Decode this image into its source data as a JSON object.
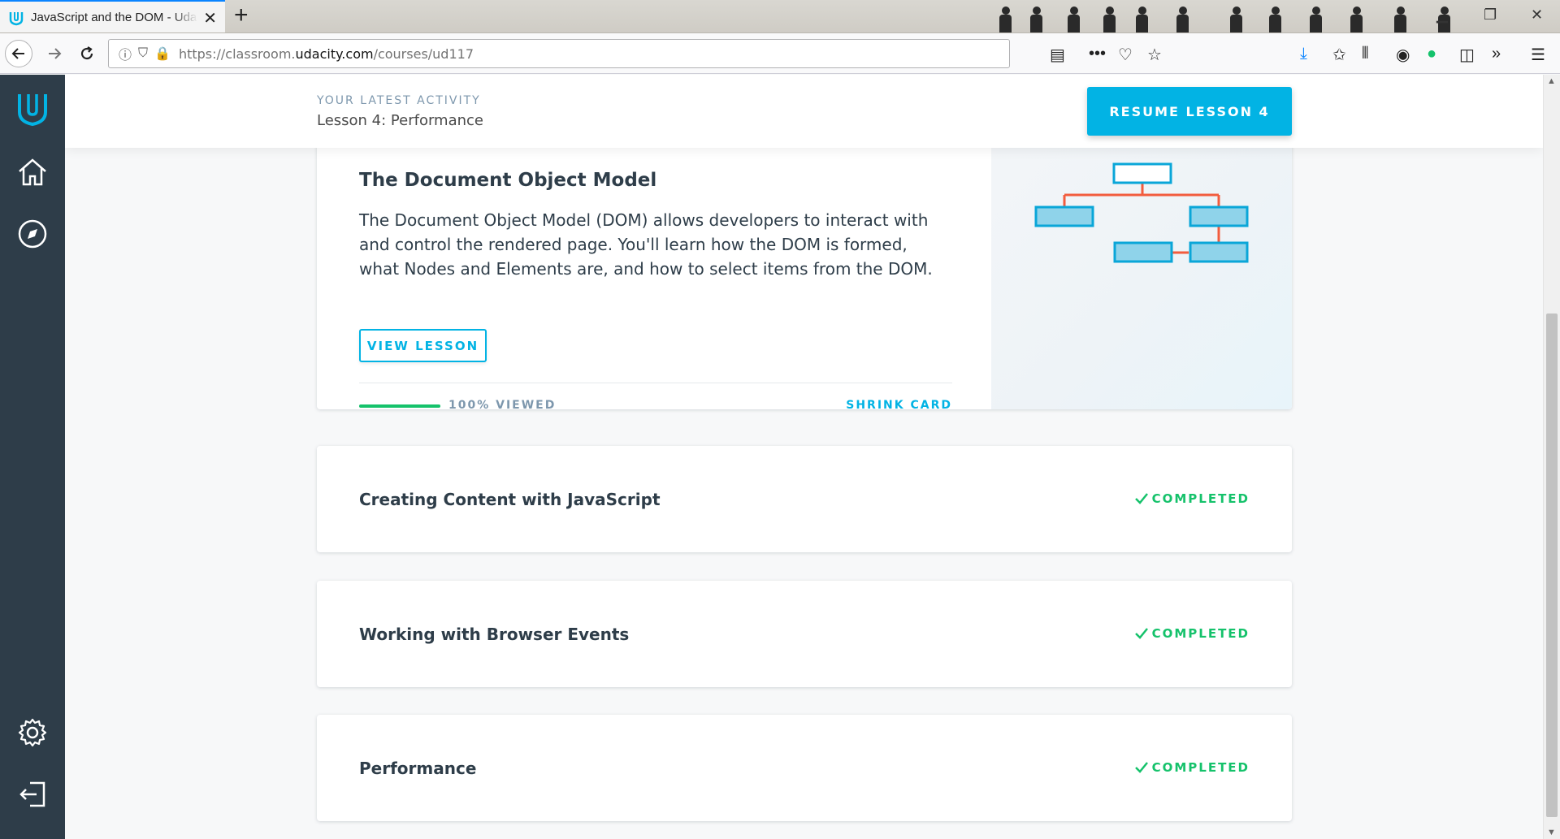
{
  "browser": {
    "tab_title": "JavaScript and the DOM - Udacity",
    "url_prefix": "https://classroom.",
    "url_domain": "udacity.com",
    "url_path": "/courses/ud117"
  },
  "header": {
    "eyebrow": "YOUR LATEST ACTIVITY",
    "activity": "Lesson 4: Performance",
    "resume_label": "RESUME LESSON 4"
  },
  "expanded_card": {
    "title": "The Document Object Model",
    "description": "The Document Object Model (DOM) allows developers to interact with and control the rendered page. You'll learn how the DOM is formed, what Nodes and Elements are, and how to select items from the DOM.",
    "view_label": "VIEW LESSON",
    "progress_fraction": 1.0,
    "progress_label": "100% VIEWED",
    "shrink_label": "SHRINK CARD"
  },
  "lessons": [
    {
      "title": "Creating Content with JavaScript",
      "status": "COMPLETED"
    },
    {
      "title": "Working with Browser Events",
      "status": "COMPLETED"
    },
    {
      "title": "Performance",
      "status": "COMPLETED"
    }
  ],
  "colors": {
    "accent": "#02b3e4",
    "sidebar": "#2e3d49",
    "completed": "#15c26b",
    "diagram_line": "#f25c3e",
    "diagram_box": "#8fd3ea"
  }
}
